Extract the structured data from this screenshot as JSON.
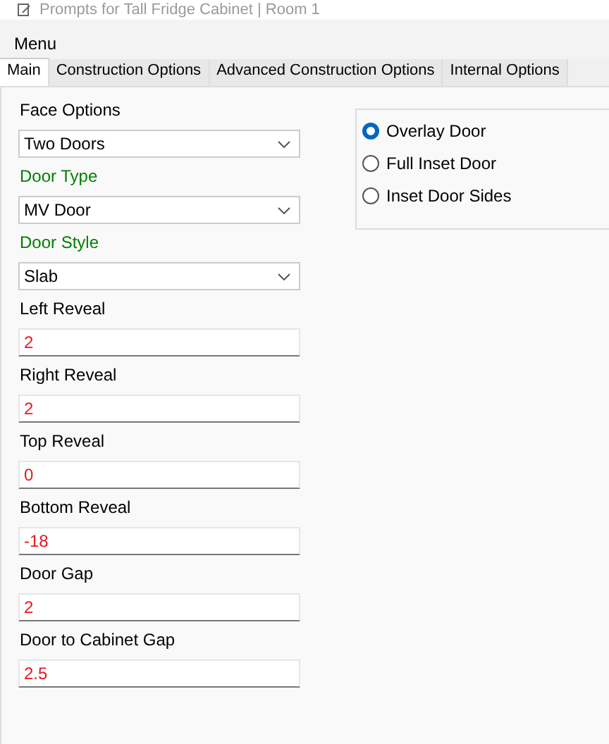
{
  "window": {
    "title": "Prompts for Tall Fridge Cabinet | Room 1"
  },
  "menu": [
    "Menu"
  ],
  "tabs": [
    {
      "label": "Main",
      "selected": true
    },
    {
      "label": "Construction Options",
      "selected": false
    },
    {
      "label": "Advanced Construction Options",
      "selected": false
    },
    {
      "label": "Internal Options",
      "selected": false
    }
  ],
  "fields": [
    {
      "label": "Face Options",
      "color": "#000000",
      "kind": "select",
      "value": "Two Doors"
    },
    {
      "label": "Door Type",
      "color": "#008000",
      "kind": "select",
      "value": "MV Door"
    },
    {
      "label": "Door Style",
      "color": "#008000",
      "kind": "select",
      "value": "Slab"
    },
    {
      "label": "Left Reveal",
      "color": "#000000",
      "kind": "text",
      "value": "2"
    },
    {
      "label": "Right Reveal",
      "color": "#000000",
      "kind": "text",
      "value": "2"
    },
    {
      "label": "Top Reveal",
      "color": "#000000",
      "kind": "text",
      "value": "0"
    },
    {
      "label": "Bottom Reveal",
      "color": "#000000",
      "kind": "text",
      "value": "-18"
    },
    {
      "label": "Door Gap",
      "color": "#000000",
      "kind": "text",
      "value": "2"
    },
    {
      "label": "Door to Cabinet Gap",
      "color": "#000000",
      "kind": "text",
      "value": "2.5"
    }
  ],
  "door_options": [
    {
      "label": "Overlay Door",
      "selected": true
    },
    {
      "label": "Full Inset Door",
      "selected": false
    },
    {
      "label": "Inset Door Sides",
      "selected": false
    }
  ]
}
